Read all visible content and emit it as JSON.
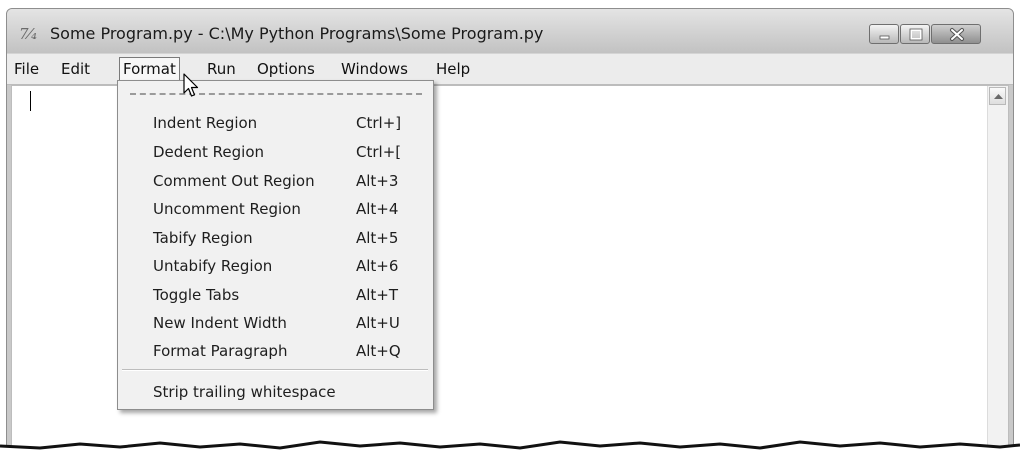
{
  "window": {
    "app_icon": "7⁄₄",
    "title": "Some Program.py - C:\\My Python Programs\\Some Program.py"
  },
  "menubar": {
    "items": [
      "File",
      "Edit",
      "Format",
      "Run",
      "Options",
      "Windows",
      "Help"
    ],
    "active": "Format"
  },
  "format_menu": {
    "items": [
      {
        "label": "Indent Region",
        "shortcut": "Ctrl+]"
      },
      {
        "label": "Dedent Region",
        "shortcut": "Ctrl+["
      },
      {
        "label": "Comment Out Region",
        "shortcut": "Alt+3"
      },
      {
        "label": "Uncomment Region",
        "shortcut": "Alt+4"
      },
      {
        "label": "Tabify Region",
        "shortcut": "Alt+5"
      },
      {
        "label": "Untabify Region",
        "shortcut": "Alt+6"
      },
      {
        "label": "Toggle Tabs",
        "shortcut": "Alt+T"
      },
      {
        "label": "New Indent Width",
        "shortcut": "Alt+U"
      },
      {
        "label": "Format Paragraph",
        "shortcut": "Alt+Q"
      }
    ],
    "extra_item": "Strip trailing whitespace"
  },
  "icons": {
    "minimize": "minimize-icon",
    "maximize": "maximize-icon",
    "close": "close-icon",
    "scroll_up": "scroll-up-arrow-icon",
    "cursor": "mouse-pointer-icon"
  }
}
